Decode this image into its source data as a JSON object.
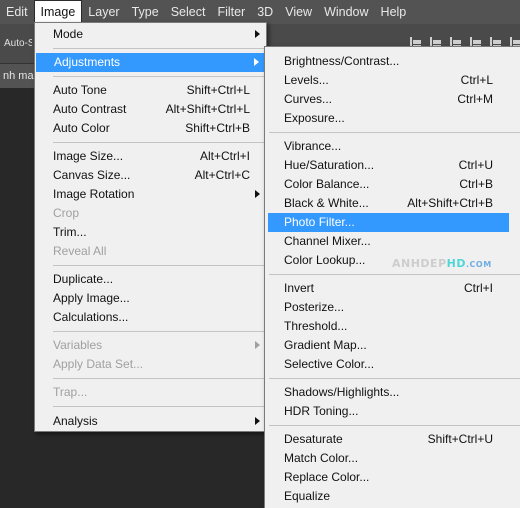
{
  "menubar": {
    "items": [
      "Edit",
      "Image",
      "Layer",
      "Type",
      "Select",
      "Filter",
      "3D",
      "View",
      "Window",
      "Help"
    ],
    "active": "Image"
  },
  "options_bar": {
    "auto_select": "Auto-S"
  },
  "doc_tab": {
    "label": "nh mau v"
  },
  "image_menu": {
    "items": [
      {
        "label": "Mode",
        "shortcut": "",
        "submenu": true,
        "disabled": false
      },
      {
        "label": "Adjustments",
        "shortcut": "",
        "submenu": true,
        "disabled": false,
        "highlighted": true
      },
      {
        "label": "Auto Tone",
        "shortcut": "Shift+Ctrl+L",
        "disabled": false
      },
      {
        "label": "Auto Contrast",
        "shortcut": "Alt+Shift+Ctrl+L",
        "disabled": false
      },
      {
        "label": "Auto Color",
        "shortcut": "Shift+Ctrl+B",
        "disabled": false
      },
      {
        "label": "Image Size...",
        "shortcut": "Alt+Ctrl+I",
        "disabled": false
      },
      {
        "label": "Canvas Size...",
        "shortcut": "Alt+Ctrl+C",
        "disabled": false
      },
      {
        "label": "Image Rotation",
        "shortcut": "",
        "submenu": true,
        "disabled": false
      },
      {
        "label": "Crop",
        "shortcut": "",
        "disabled": true
      },
      {
        "label": "Trim...",
        "shortcut": "",
        "disabled": false
      },
      {
        "label": "Reveal All",
        "shortcut": "",
        "disabled": true
      },
      {
        "label": "Duplicate...",
        "shortcut": "",
        "disabled": false
      },
      {
        "label": "Apply Image...",
        "shortcut": "",
        "disabled": false
      },
      {
        "label": "Calculations...",
        "shortcut": "",
        "disabled": false
      },
      {
        "label": "Variables",
        "shortcut": "",
        "submenu": true,
        "disabled": true
      },
      {
        "label": "Apply Data Set...",
        "shortcut": "",
        "disabled": true
      },
      {
        "label": "Trap...",
        "shortcut": "",
        "disabled": true
      },
      {
        "label": "Analysis",
        "shortcut": "",
        "submenu": true,
        "disabled": false
      }
    ]
  },
  "adjustments_menu": {
    "items": [
      {
        "label": "Brightness/Contrast...",
        "shortcut": ""
      },
      {
        "label": "Levels...",
        "shortcut": "Ctrl+L"
      },
      {
        "label": "Curves...",
        "shortcut": "Ctrl+M"
      },
      {
        "label": "Exposure...",
        "shortcut": ""
      },
      {
        "label": "Vibrance...",
        "shortcut": ""
      },
      {
        "label": "Hue/Saturation...",
        "shortcut": "Ctrl+U"
      },
      {
        "label": "Color Balance...",
        "shortcut": "Ctrl+B"
      },
      {
        "label": "Black & White...",
        "shortcut": "Alt+Shift+Ctrl+B"
      },
      {
        "label": "Photo Filter...",
        "shortcut": "",
        "highlighted": true
      },
      {
        "label": "Channel Mixer...",
        "shortcut": ""
      },
      {
        "label": "Color Lookup...",
        "shortcut": ""
      },
      {
        "label": "Invert",
        "shortcut": "Ctrl+I"
      },
      {
        "label": "Posterize...",
        "shortcut": ""
      },
      {
        "label": "Threshold...",
        "shortcut": ""
      },
      {
        "label": "Gradient Map...",
        "shortcut": ""
      },
      {
        "label": "Selective Color...",
        "shortcut": ""
      },
      {
        "label": "Shadows/Highlights...",
        "shortcut": ""
      },
      {
        "label": "HDR Toning...",
        "shortcut": ""
      },
      {
        "label": "Desaturate",
        "shortcut": "Shift+Ctrl+U"
      },
      {
        "label": "Match Color...",
        "shortcut": ""
      },
      {
        "label": "Replace Color...",
        "shortcut": ""
      },
      {
        "label": "Equalize",
        "shortcut": ""
      }
    ]
  },
  "watermark": {
    "main": "ANHDEP",
    "accent": "HD",
    "suffix": ".COM"
  },
  "colors": {
    "highlight": "#3399ff",
    "menu_bg": "#f0f0f0",
    "menubar_bg": "#535353",
    "disabled_text": "#a0a0a0"
  }
}
